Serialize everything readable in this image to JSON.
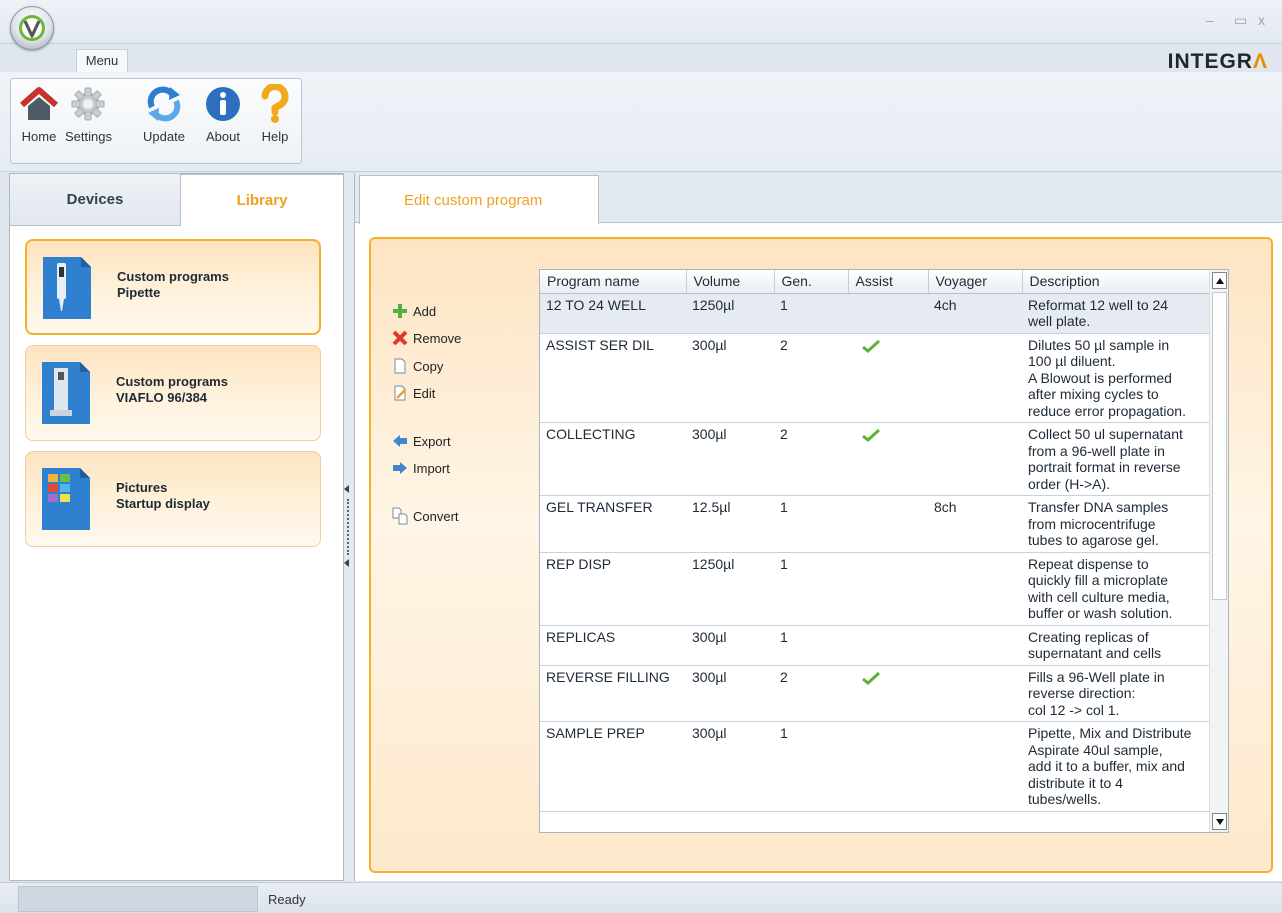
{
  "window": {
    "minimize": "–",
    "maximize": "▭",
    "close": "x"
  },
  "menu": {
    "label": "Menu"
  },
  "brand": {
    "name": "INTEGR",
    "accent": "Λ",
    "accent_color": "#e98b00"
  },
  "ribbon": {
    "buttons": [
      {
        "label": "Home",
        "icon": "home-icon"
      },
      {
        "label": "Settings",
        "icon": "gear-icon"
      },
      {
        "label": "Update",
        "icon": "refresh-icon"
      },
      {
        "label": "About",
        "icon": "info-icon"
      },
      {
        "label": "Help",
        "icon": "help-icon"
      }
    ]
  },
  "left": {
    "tabs": [
      {
        "label": "Devices"
      },
      {
        "label": "Library",
        "active": true
      }
    ],
    "cards": [
      {
        "line1": "Custom programs",
        "line2": "Pipette",
        "icon": "pipette-icon",
        "selected": true
      },
      {
        "line1": "Custom programs",
        "line2": "VIAFLO 96/384",
        "icon": "viaflo-icon"
      },
      {
        "line1": "Pictures",
        "line2": "Startup display",
        "icon": "pictures-icon"
      }
    ]
  },
  "main": {
    "tab": "Edit custom program",
    "actions": [
      {
        "label": "Add",
        "icon": "add-icon"
      },
      {
        "label": "Remove",
        "icon": "remove-icon"
      },
      {
        "label": "Copy",
        "icon": "copy-icon"
      },
      {
        "label": "Edit",
        "icon": "edit-icon"
      },
      {
        "label": "Export",
        "icon": "export-icon"
      },
      {
        "label": "Import",
        "icon": "import-icon"
      },
      {
        "label": "Convert",
        "icon": "convert-icon"
      }
    ],
    "table": {
      "columns": [
        "Program name",
        "Volume",
        "Gen.",
        "Assist",
        "Voyager",
        "Description"
      ],
      "rows": [
        {
          "name": "12 TO 24 WELL",
          "volume": "1250µl",
          "gen": "1",
          "assist": false,
          "voyager": "4ch",
          "description": [
            "Reformat 12 well to 24",
            "well plate."
          ]
        },
        {
          "name": "ASSIST SER DIL",
          "volume": "300µl",
          "gen": "2",
          "assist": true,
          "voyager": "",
          "description": [
            "Dilutes 50 µl sample in",
            "100 µl diluent.",
            "A Blowout is performed",
            "after mixing cycles to",
            "reduce error propagation."
          ]
        },
        {
          "name": "COLLECTING",
          "volume": "300µl",
          "gen": "2",
          "assist": true,
          "voyager": "",
          "description": [
            "Collect 50 ul supernatant",
            "from a 96-well plate in",
            "portrait format in reverse",
            "order (H->A)."
          ]
        },
        {
          "name": "GEL TRANSFER",
          "volume": "12.5µl",
          "gen": "1",
          "assist": false,
          "voyager": "8ch",
          "description": [
            "Transfer DNA samples",
            "from microcentrifuge",
            "tubes to agarose gel."
          ]
        },
        {
          "name": "REP DISP",
          "volume": "1250µl",
          "gen": "1",
          "assist": false,
          "voyager": "",
          "description": [
            "Repeat dispense to",
            "quickly fill a microplate",
            "with cell culture media,",
            "buffer or wash solution."
          ]
        },
        {
          "name": "REPLICAS",
          "volume": "300µl",
          "gen": "1",
          "assist": false,
          "voyager": "",
          "description": [
            "Creating replicas of",
            "supernatant and cells"
          ]
        },
        {
          "name": "REVERSE FILLING",
          "volume": "300µl",
          "gen": "2",
          "assist": true,
          "voyager": "",
          "description": [
            "Fills a 96-Well plate in",
            "reverse direction:",
            "col 12 -> col 1."
          ]
        },
        {
          "name": "SAMPLE PREP",
          "volume": "300µl",
          "gen": "1",
          "assist": false,
          "voyager": "",
          "description": [
            "Pipette, Mix and Distribute",
            "Aspirate 40ul sample,",
            "add it to a buffer, mix and",
            "distribute it to 4",
            "tubes/wells."
          ]
        }
      ]
    }
  },
  "status": {
    "text": "Ready"
  }
}
